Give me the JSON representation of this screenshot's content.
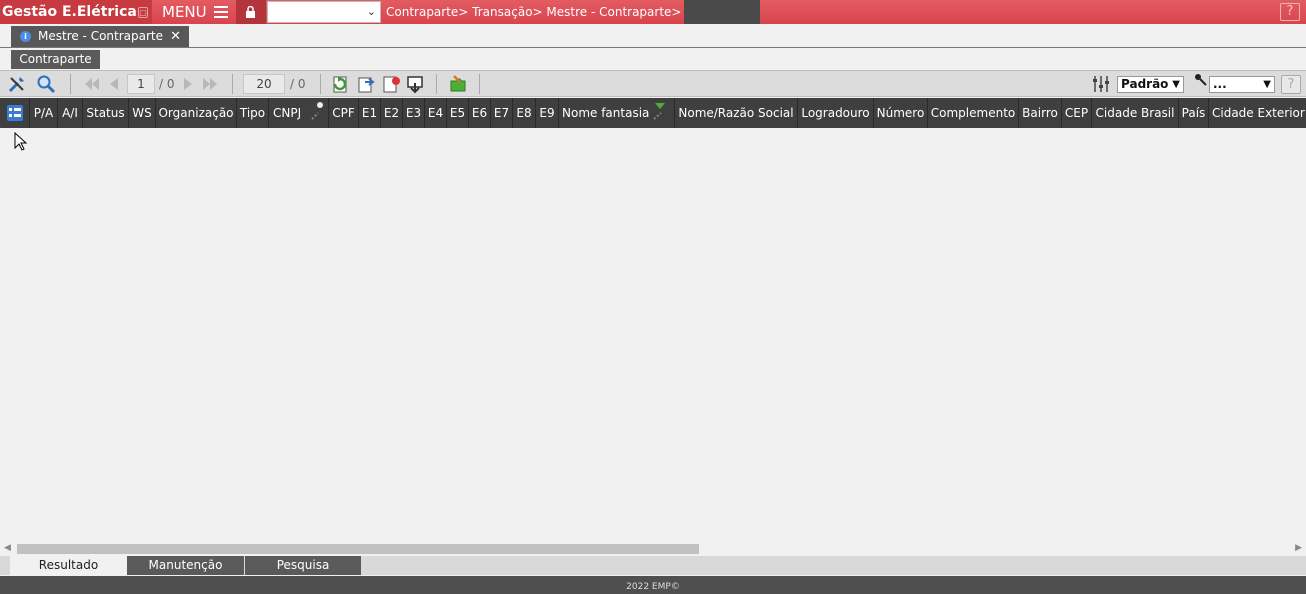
{
  "header": {
    "app_title": "Gestão E.Elétrica",
    "menu_label": "MENU",
    "breadcrumb": "Contraparte> Transação> Mestre - Contraparte>",
    "transaction_select_value": "",
    "help_label": "?"
  },
  "tabs": {
    "doc_tab_label": "Mestre - Contraparte",
    "doc_tab_close": "✕",
    "sub_tab_label": "Contraparte"
  },
  "toolbar": {
    "page_current": "1",
    "page_total": "/ 0",
    "rows_per_page": "20",
    "rows_total": "/ 0",
    "view_select_value": "Padrão",
    "key_select_value": "...",
    "help_label": "?"
  },
  "grid": {
    "columns": [
      "P/A",
      "A/I",
      "Status",
      "WS",
      "Organização",
      "Tipo",
      "CNPJ",
      "CPF",
      "E1",
      "E2",
      "E3",
      "E4",
      "E5",
      "E6",
      "E7",
      "E8",
      "E9",
      "Nome fantasia",
      "Nome/Razão Social",
      "Logradouro",
      "Número",
      "Complemento",
      "Bairro",
      "CEP",
      "Cidade Brasil",
      "País",
      "Cidade Exterior"
    ],
    "rows": []
  },
  "bottom_tabs": [
    "Resultado",
    "Manutenção",
    "Pesquisa"
  ],
  "footer": {
    "text": "2022 EMP©"
  },
  "colors": {
    "topbar": "#d9444c",
    "brand": "#c73a40",
    "grid_header": "#3f3f3f",
    "dark_tab": "#5a5a5a"
  },
  "icons": [
    "tools-icon",
    "search-icon",
    "first-page-icon",
    "prev-page-icon",
    "next-page-icon",
    "last-page-icon",
    "refresh-icon",
    "export-icon",
    "report-icon",
    "download-icon",
    "puzzle-icon",
    "filter-settings-icon",
    "key-icon",
    "grid-menu-icon",
    "lock-icon",
    "info-icon"
  ]
}
